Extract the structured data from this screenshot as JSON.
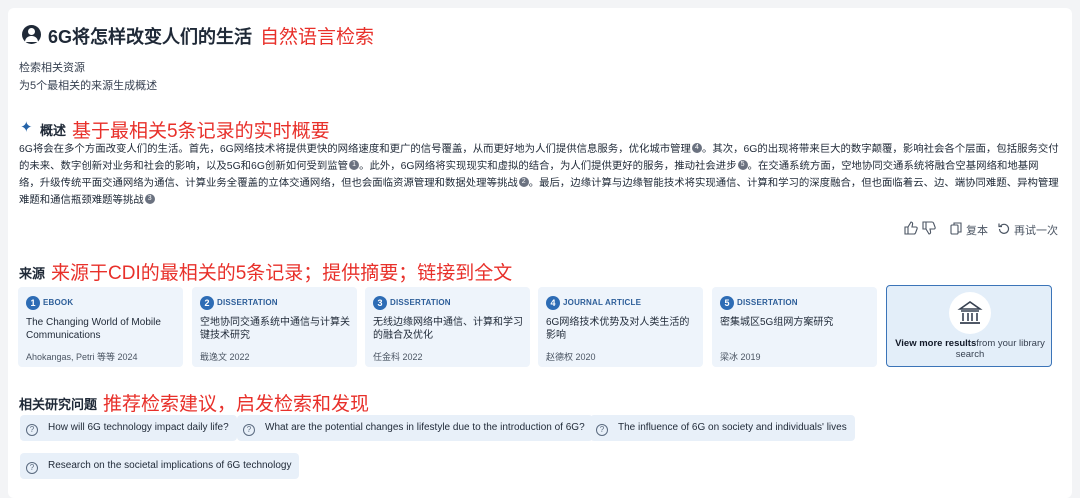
{
  "header": {
    "question": "6G将怎样改变人们的生活",
    "note": "自然语言检索",
    "sub1": "检索相关资源",
    "sub2": "为5个最相关的来源生成概述"
  },
  "overview": {
    "title": "概述",
    "note": "基于最相关5条记录的实时概要",
    "segments": [
      {
        "text": "6G将会在多个方面改变人们的生活。首先，6G网络技术将提供更快的网络速度和更广的信号覆盖，从而更好地为人们提供信息服务，优化城市管理",
        "cite": "4"
      },
      {
        "text": "。其次，6G的出现将带来巨大的数字颠覆，影响社会各个层面，包括服务交付的未来、数字创新对业务和社会的影响，以及5G和6G创新如何受到监管",
        "cite": "1"
      },
      {
        "text": "。此外，6G网络将实现现实和虚拟的结合，为人们提供更好的服务，推动社会进步",
        "cite": "5"
      },
      {
        "text": "。在交通系统方面，空地协同交通系统将融合空基网络和地基网络，升级传统平面交通网络为通信、计算业务全覆盖的立体交通网络，但也会面临资源管理和数据处理等挑战",
        "cite": "2"
      },
      {
        "text": "。最后，边缘计算与边缘智能技术将实现通信、计算和学习的深度融合，但也面临着云、边、端协同难题、异构管理难题和通信瓶颈难题等挑战",
        "cite": "3"
      }
    ],
    "actions": {
      "copy": "复本",
      "retry": "再试一次"
    }
  },
  "sources": {
    "title": "来源",
    "note": "来源于CDI的最相关的5条记录；提供摘要；链接到全文",
    "items": [
      {
        "num": "1",
        "type": "EBOOK",
        "name": "The Changing World of Mobile Communications",
        "meta": "Ahokangas, Petri 等等 2024"
      },
      {
        "num": "2",
        "type": "DISSERTATION",
        "name": "空地协同交通系统中通信与计算关键技术研究",
        "meta": "戢逸文 2022"
      },
      {
        "num": "3",
        "type": "DISSERTATION",
        "name": "无线边缘网络中通信、计算和学习的融合及优化",
        "meta": "任金科 2022"
      },
      {
        "num": "4",
        "type": "JOURNAL ARTICLE",
        "name": "6G网络技术优势及对人类生活的影响",
        "meta": "赵德权 2020"
      },
      {
        "num": "5",
        "type": "DISSERTATION",
        "name": "密集城区5G组网方案研究",
        "meta": "梁冰 2019"
      }
    ],
    "more_bold": "View more results",
    "more_rest": "from your library search"
  },
  "related": {
    "title": "相关研究问题",
    "note": "推荐检索建议，启发检索和发现",
    "chips": [
      "How will 6G technology impact daily life?",
      "What are the potential changes in lifestyle due to the introduction of 6G?",
      "The influence of 6G on society and individuals' lives",
      "Research on the societal implications of 6G technology"
    ]
  }
}
